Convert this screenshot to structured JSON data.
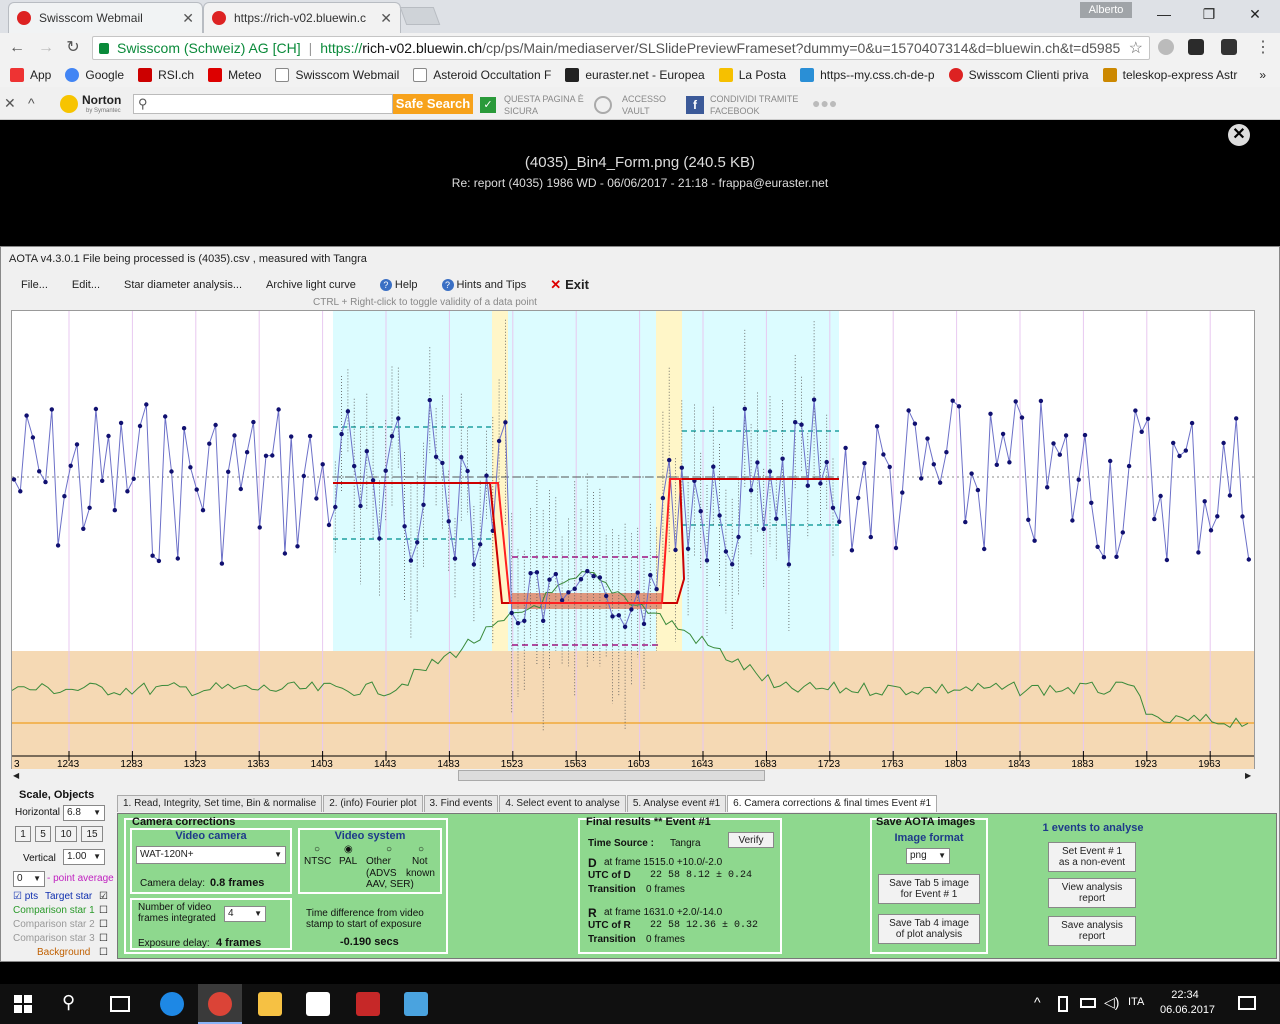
{
  "browser": {
    "tabs": [
      {
        "title": "Swisscom Webmail"
      },
      {
        "title": "https://rich-v02.bluewin.c"
      }
    ],
    "profile_name": "Alberto",
    "window_controls": {
      "minimize": "—",
      "restore": "❐",
      "close": "✕"
    },
    "nav": {
      "back": "←",
      "forward": "→",
      "reload": "↻"
    },
    "address": {
      "origin_label": "Swisscom (Schweiz) AG [CH]",
      "url_scheme": "https://",
      "url_host": "rich-v02.bluewin.ch",
      "url_path": "/cp/ps/Main/mediaserver/SLSlidePreviewFrameset?dummy=0&u=1570407314&d=bluewin.ch&t=d5985"
    },
    "bookmarks": [
      {
        "label": "App",
        "color": "#e33"
      },
      {
        "label": "Google",
        "color": "#4285f4"
      },
      {
        "label": "RSI.ch",
        "color": "#c00"
      },
      {
        "label": "Meteo",
        "color": "#d00"
      },
      {
        "label": "Swisscom Webmail",
        "color": "#888"
      },
      {
        "label": "Asteroid Occultation F",
        "color": "#888"
      },
      {
        "label": "euraster.net - Europea",
        "color": "#222"
      },
      {
        "label": "La Posta",
        "color": "#f6c000"
      },
      {
        "label": "https--my.css.ch-de-p",
        "color": "#2a8fd6"
      },
      {
        "label": "Swisscom Clienti priva",
        "color": "#d22"
      },
      {
        "label": "teleskop-express Astr",
        "color": "#c80"
      }
    ],
    "bookmarks_more": "»"
  },
  "norton": {
    "logo": "Norton",
    "logo_sub": "by Symantec",
    "safe_search": "Safe Search",
    "buttons": [
      {
        "line1": "QUESTA PAGINA È",
        "line2": "SICURA"
      },
      {
        "line1": "ACCESSO",
        "line2": "VAULT"
      },
      {
        "line1": "CONDIVIDI TRAMITE",
        "line2": "FACEBOOK"
      }
    ]
  },
  "viewer": {
    "title": "(4035)_Bin4_Form.png (240.5 KB)",
    "subtitle": "Re: report (4035) 1986 WD - 06/06/2017 - 21:18 - frappa@euraster.net",
    "close": "✕"
  },
  "app": {
    "title": "AOTA v4.3.0.1    File being processed is  (4035).csv ,  measured with Tangra",
    "menu": {
      "file": "File...",
      "edit": "Edit...",
      "star": "Star diameter analysis...",
      "archive": "Archive light curve",
      "help": "Help",
      "hints": "Hints and Tips",
      "exit": "Exit"
    },
    "ctrl_hint": "CTRL + Right-click    to toggle validity of a data point",
    "x_axis_ticks": [
      "3",
      "1243",
      "1283",
      "1323",
      "1363",
      "1403",
      "1443",
      "1483",
      "1523",
      "1563",
      "1603",
      "1643",
      "1683",
      "1723",
      "1763",
      "1803",
      "1843",
      "1883",
      "1923",
      "1963"
    ],
    "scale_panel": {
      "title": "Scale,  Objects",
      "horizontal_label": "Horizontal",
      "horizontal_value": "6.8",
      "zoom_buttons": [
        "1",
        "5",
        "10",
        "15"
      ],
      "vertical_label": "Vertical",
      "vertical_value": "1.00",
      "point_average_value": "0",
      "point_average_label": "- point average",
      "pts_label": "pts",
      "target_label": "Target star",
      "comp1": "Comparison star 1",
      "comp2": "Comparison star 2",
      "comp3": "Comparison star 3",
      "background": "Background"
    },
    "tabs": [
      "1.  Read, Integrity, Set time, Bin & normalise",
      "2. (info)  Fourier plot",
      "3. Find events",
      "4. Select event to analyse",
      "5. Analyse event #1",
      "6. Camera corrections & final times Event #1"
    ],
    "camera": {
      "title": "Camera corrections",
      "video_camera_title": "Video camera",
      "camera_value": "WAT-120N+",
      "camera_delay_label": "Camera delay:",
      "camera_delay_value": "0.8 frames",
      "video_system_title": "Video system",
      "vs_ntsc": "NTSC",
      "vs_pal": "PAL",
      "vs_other": "Other",
      "vs_other_sub": "(ADVS\nAAV, SER)",
      "vs_not": "Not",
      "vs_known": "known",
      "frames_label": "Number of video\nframes integrated",
      "frames_value": "4",
      "exposure_label": "Exposure delay:",
      "exposure_value": "4 frames",
      "timediff_label": "Time difference from video\nstamp to start of exposure",
      "timediff_value": "-0.190 secs"
    },
    "final": {
      "title": "Final results  **  Event #1",
      "verify": "Verify",
      "time_source_label": "Time Source :",
      "time_source_value": "Tangra",
      "d_label": "D",
      "d_frame": "at frame 1515.0  +10.0/-2.0",
      "utc_d_label": "UTC of D",
      "utc_d_value": "22 58   8.12 ± 0.24",
      "trans_d_label": "Transition",
      "trans_d_value": "0 frames",
      "r_label": "R",
      "r_frame": "at frame 1631.0  +2.0/-14.0",
      "utc_r_label": "UTC of R",
      "utc_r_value": "22 58  12.36 ± 0.32",
      "trans_r_label": "Transition",
      "trans_r_value": "0 frames"
    },
    "save": {
      "title": "Save AOTA images",
      "format_label": "Image format",
      "format_value": "png",
      "tab5": "Save Tab 5 image\nfor Event # 1",
      "tab4": "Save Tab 4 image\nof plot analysis"
    },
    "events": {
      "title": "1 events to analyse",
      "nonevent": "Set Event # 1\nas a non-event",
      "view": "View analysis\nreport",
      "save": "Save analysis\nreport"
    }
  },
  "chart_data": {
    "type": "line",
    "x_ticks": [
      1243,
      1283,
      1323,
      1363,
      1403,
      1443,
      1483,
      1523,
      1563,
      1603,
      1643,
      1683,
      1723,
      1763,
      1803,
      1843,
      1883,
      1923,
      1963
    ],
    "event": {
      "D_frame": 1515.0,
      "R_frame": 1631.0
    }
  },
  "taskbar": {
    "lang": "ITA",
    "time": "22:34",
    "date": "06.06.2017"
  }
}
